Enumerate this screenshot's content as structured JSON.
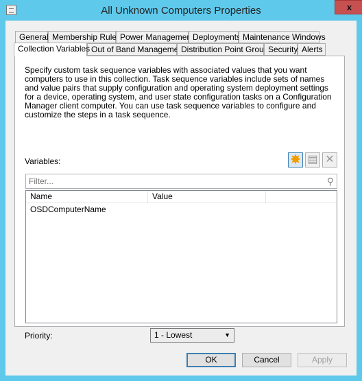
{
  "window": {
    "title": "All Unknown Computers Properties",
    "close": "x"
  },
  "tabs_row1": [
    "General",
    "Membership Rules",
    "Power Management",
    "Deployments",
    "Maintenance Windows"
  ],
  "tabs_row2": [
    "Collection Variables",
    "Out of Band Management",
    "Distribution Point Groups",
    "Security",
    "Alerts"
  ],
  "selected_tab": "Collection Variables",
  "description": "Specify custom task sequence variables with associated values that you want computers to use in this collection. Task sequence variables include sets of names and value pairs that supply configuration and operating system deployment settings for a device, operating system, and user state configuration tasks on a Configuration Manager client computer. You can use task sequence variables to configure and customize the steps in a task sequence.",
  "variables_label": "Variables:",
  "toolbar": {
    "add_icon": "starburst-icon",
    "properties_icon": "properties-icon",
    "delete_icon": "delete-x-icon"
  },
  "filter": {
    "placeholder": "Filter..."
  },
  "list": {
    "columns": [
      "Name",
      "Value",
      ""
    ],
    "rows": [
      {
        "name": "OSDComputerName",
        "value": ""
      }
    ]
  },
  "priority": {
    "label": "Priority:",
    "value": "1 - Lowest"
  },
  "buttons": {
    "ok": "OK",
    "cancel": "Cancel",
    "apply": "Apply"
  }
}
